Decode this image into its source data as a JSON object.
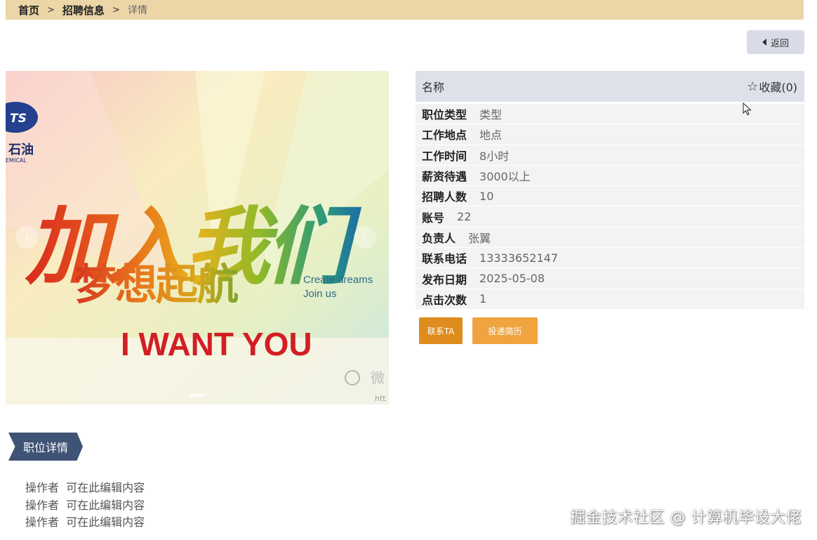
{
  "breadcrumb": {
    "home": "首页",
    "separator": ">",
    "section": "招聘信息",
    "current": "详情"
  },
  "back_button": {
    "label": "返回",
    "icon": "caret-left-icon"
  },
  "banner": {
    "headline_cn": "加入我们",
    "subline_cn": "梦想起航",
    "english_line1": "Create dreams",
    "english_line2": "Join us",
    "big_text": "I WANT YOU",
    "logo_text": "石油",
    "logo_sub": "EMICAL",
    "corner_text": "htt",
    "watermark_glyph": "微",
    "prev_arrow": "‹",
    "next_arrow": "›"
  },
  "job": {
    "name_label": "名称",
    "favorite": {
      "label": "收藏(0)",
      "icon": "star-outline-icon"
    },
    "fields": [
      {
        "label": "职位类型",
        "value": "类型"
      },
      {
        "label": "工作地点",
        "value": "地点"
      },
      {
        "label": "工作时间",
        "value": "8小时"
      },
      {
        "label": "薪资待遇",
        "value": "3000以上"
      },
      {
        "label": "招聘人数",
        "value": "10"
      },
      {
        "label": "账号",
        "value": "22"
      },
      {
        "label": "负责人",
        "value": "张翼"
      },
      {
        "label": "联系电话",
        "value": "13333652147"
      },
      {
        "label": "发布日期",
        "value": "2025-05-08"
      },
      {
        "label": "点击次数",
        "value": "1"
      }
    ],
    "contact_button": "联系TA",
    "resume_button": "投递简历"
  },
  "details": {
    "tag": "职位详情",
    "lines": [
      "操作者  可在此编辑内容",
      "操作者  可在此编辑内容",
      "操作者  可在此编辑内容"
    ]
  },
  "watermark": "掘金技术社区 @ 计算机毕设大佬",
  "colors": {
    "breadcrumb_bg": "#ecd6a8",
    "header_bg": "#dfe1ea",
    "contact_btn": "#de8c1d",
    "resume_btn": "#f0a440",
    "tag_bg": "#3f5374"
  }
}
